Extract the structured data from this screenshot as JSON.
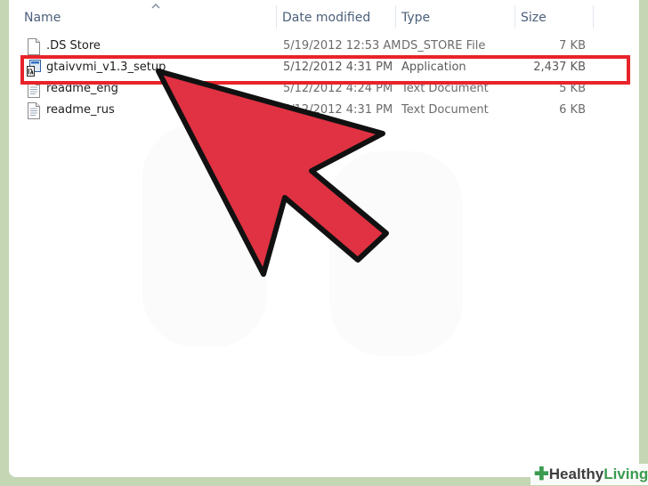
{
  "columns": {
    "name": "Name",
    "date": "Date modified",
    "type": "Type",
    "size": "Size"
  },
  "files": [
    {
      "name": ".DS Store",
      "date": "5/19/2012 12:53 AM",
      "type": "DS_STORE File",
      "size": "7 KB",
      "icon": "document-icon"
    },
    {
      "name": "gtaivvmi_v1.3_setup",
      "date": "5/12/2012 4:31 PM",
      "type": "Application",
      "size": "2,437 KB",
      "icon": "application-icon",
      "selected": true
    },
    {
      "name": "readme_eng",
      "date": "5/12/2012 4:24 PM",
      "type": "Text Document",
      "size": "5 KB",
      "icon": "text-document-icon"
    },
    {
      "name": "readme_rus",
      "date": "5/12/2012 4:31 PM",
      "type": "Text Document",
      "size": "6 KB",
      "icon": "text-document-icon"
    }
  ],
  "colors": {
    "highlight": "#e8232a",
    "arrow": "#e03242",
    "header_text": "#4c607a"
  },
  "watermark": {
    "part1": "Healthy",
    "part2": "Living"
  }
}
